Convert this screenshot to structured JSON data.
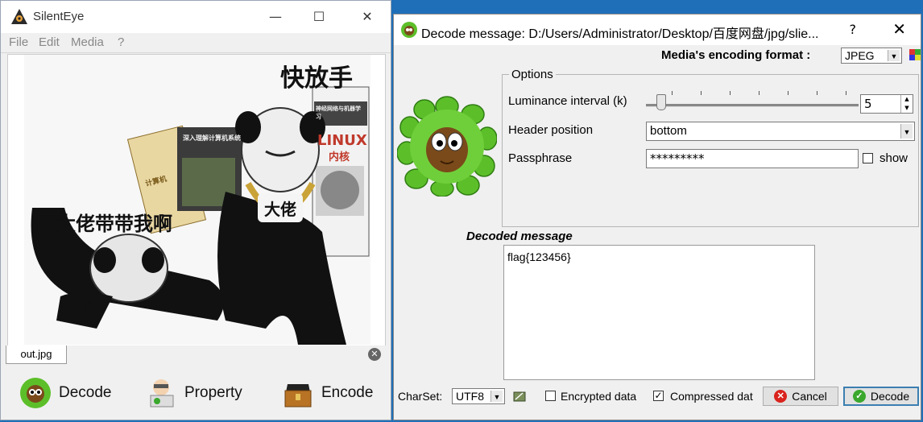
{
  "left_window": {
    "title": "SilentEye",
    "controls": {
      "minimize": "—",
      "maximize": "☐",
      "close": "✕"
    },
    "menu": [
      "File",
      "Edit",
      "Media",
      "?"
    ],
    "image": {
      "texts": [
        "快放手",
        "大佬带带我啊",
        "大佬",
        "我"
      ],
      "book_titles": [
        "深入理解计算机系统",
        "神经网络与机器学习",
        "LINUX",
        "内核",
        "计算机"
      ]
    },
    "tab": {
      "label": "out.jpg",
      "close_icon": "close-circle-icon"
    },
    "toolbar": [
      {
        "label": "Decode",
        "icon": "owl-leaf-icon"
      },
      {
        "label": "Property",
        "icon": "inspector-icon"
      },
      {
        "label": "Encode",
        "icon": "treasure-chest-icon"
      }
    ]
  },
  "right_window": {
    "title": "Decode message: D:/Users/Administrator/Desktop/百度网盘/jpg/slie...",
    "help": "?",
    "close": "✕",
    "media_encoding": {
      "label": "Media's encoding format :",
      "value": "JPEG"
    },
    "options": {
      "legend": "Options",
      "luminance": {
        "label": "Luminance interval (k)",
        "value": "5",
        "slider_fraction": 0.07
      },
      "header_position": {
        "label": "Header position",
        "value": "bottom"
      },
      "passphrase": {
        "label": "Passphrase",
        "value": "*********",
        "show_label": "show",
        "show_checked": false
      }
    },
    "decoded": {
      "label": "Decoded message",
      "value": "flag{123456}"
    },
    "bottom": {
      "charset_label": "CharSet:",
      "charset_value": "UTF8",
      "encrypted_label": "Encrypted data",
      "encrypted_checked": false,
      "compressed_label": "Compressed dat",
      "compressed_checked": true,
      "cancel_label": "Cancel",
      "decode_label": "Decode"
    }
  },
  "colors": {
    "desktop": "#1f6fb8",
    "window_bg": "#f0f0f0",
    "leaf_green": "#5cbf2a",
    "cancel_red": "#d9231c",
    "decode_green": "#3aa82d"
  }
}
